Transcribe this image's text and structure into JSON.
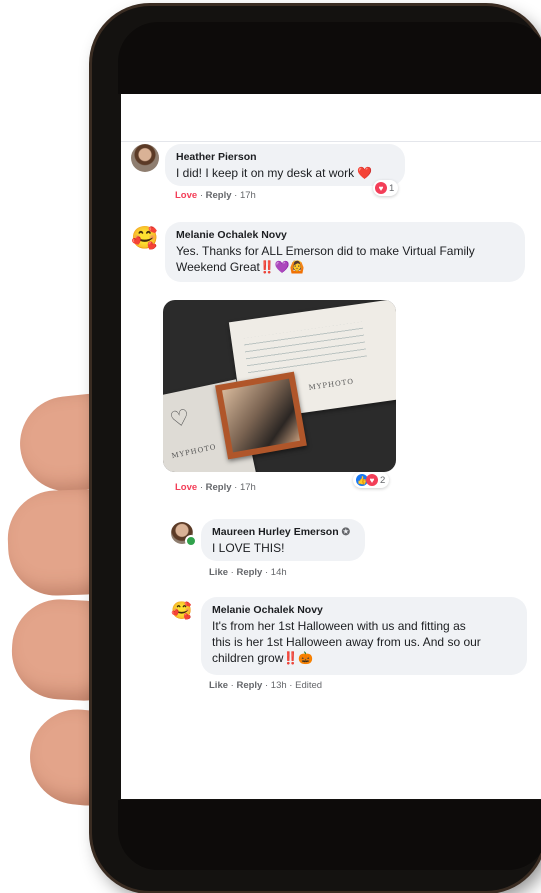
{
  "comments": [
    {
      "author": "Heather Pierson",
      "text": "I did! I keep it on my desk at work ❤️",
      "action_primary": "Love",
      "action_reply": "Reply",
      "time": "17h",
      "reaction_count": "1"
    },
    {
      "author": "Melanie Ochalek Novy",
      "text_line1": "Yes. Thanks for ALL Emerson did to make Virtual Family",
      "text_line2": "Weekend Great‼️💜🙆",
      "action_primary": "Love",
      "action_reply": "Reply",
      "time": "17h",
      "reaction_count": "2",
      "avatar_emoji": "🥰",
      "attachment": {
        "brand_text": "MYPHOTO"
      }
    }
  ],
  "replies": [
    {
      "author": "Maureen Hurley Emerson",
      "text": "I LOVE THIS!",
      "action_primary": "Like",
      "action_reply": "Reply",
      "time": "14h"
    },
    {
      "author": "Melanie Ochalek Novy",
      "text_line1": "It's from her 1st Halloween with us and fitting as",
      "text_line2": "this is her 1st Halloween away from us. And so our",
      "text_line3": "children grow‼️🎃",
      "action_primary": "Like",
      "action_reply": "Reply",
      "time": "13h",
      "edited": "Edited",
      "avatar_emoji": "🥰"
    }
  ],
  "colors": {
    "love": "#f33e58",
    "like": "#1877f2",
    "bubble": "#f0f2f5",
    "meta": "#65676b"
  }
}
